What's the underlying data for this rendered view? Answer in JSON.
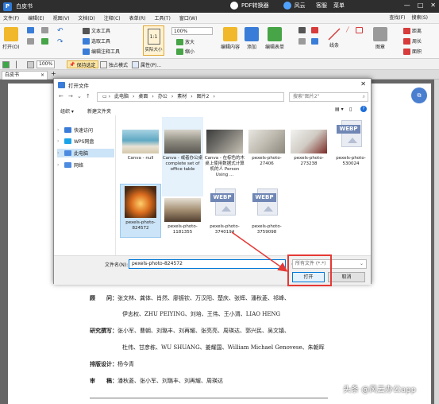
{
  "app": {
    "title": "白皮书",
    "center_items": [
      "PDF转换器",
      "风云"
    ],
    "right_items": [
      "客服",
      "菜单"
    ],
    "window_buttons": [
      "—",
      "□",
      "✕"
    ]
  },
  "menu": {
    "items": [
      "文件(F)",
      "编辑(E)",
      "视图(V)",
      "文档(D)",
      "注释(C)",
      "表单(R)",
      "工具(T)",
      "窗口(W)"
    ],
    "right": [
      "查找(F)",
      "搜索(S)"
    ]
  },
  "toolbar": {
    "open": "打开(O)",
    "text_tool": "文本工具",
    "select_tool": "选取工具",
    "edit_note_tool": "编辑注释工具",
    "actual_size": "实际大小",
    "zoom": "100%",
    "zoom_in": "放大",
    "zoom_out": "缩小",
    "edit_content": "编辑内容",
    "add": "添加",
    "edit_form": "编辑表单",
    "line": "线条",
    "stamp": "图章",
    "perimeter": "周长",
    "area": "面积",
    "distance": "距离"
  },
  "toolbar2": {
    "zoom2": "100%",
    "keep_selected": "保持选定",
    "single_mode": "独占模式",
    "properties": "属性(P)..."
  },
  "tab": {
    "label": "白皮书",
    "close": "×",
    "plus": "+"
  },
  "dialog": {
    "title": "打开文件",
    "close": "✕",
    "breadcrumb": [
      "此电脑",
      "桌面",
      "办公",
      "素材",
      "图片2"
    ],
    "search_placeholder": "搜索\"图片2\"",
    "organize": "组织 ▾",
    "new_folder": "新建文件夹",
    "nav": [
      {
        "label": "快速访问",
        "icon": "star-icon"
      },
      {
        "label": "WPS网盘",
        "icon": "cloud-icon"
      },
      {
        "label": "此电脑",
        "icon": "computer-icon"
      },
      {
        "label": "网络",
        "icon": "network-icon"
      }
    ],
    "files": [
      {
        "name": "Canva - null",
        "kind": "ocean"
      },
      {
        "name": "Canva - 或者办公桌 complete set of office table",
        "kind": "desk"
      },
      {
        "name": "Canva - 在棕色的木桌上使用数据式计算机的人 Person Using ...",
        "kind": "laptop"
      },
      {
        "name": "pexels-photo-27406",
        "kind": "laptop2"
      },
      {
        "name": "pexels-photo-273238",
        "kind": "office"
      },
      {
        "name": "pexels-photo-530024",
        "kind": "webp"
      },
      {
        "name": "pexels-photo-824572",
        "kind": "tree"
      },
      {
        "name": "pexels-photo-1181355",
        "kind": "meeting"
      },
      {
        "name": "pexels-photo-3740194",
        "kind": "webp"
      },
      {
        "name": "pexels-photo-3759098",
        "kind": "webp"
      }
    ],
    "filename_label": "文件名(N):",
    "filename_value": "pexels-photo-824572",
    "filetype": "所有文件 (*.*)",
    "open_button": "打开",
    "cancel_button": "取消"
  },
  "document": {
    "lines": [
      {
        "label": "顾　　问：",
        "text": "张文林、龚体、肖然、廖振钦、万汉阳、楚庆、张辉、潘秋菱、祁峰、"
      },
      {
        "label": "",
        "text": "伊志权、ZHU PEIYING、刘培、王伟、王小渭、LIAO HENG"
      },
      {
        "label": "研究撰写：",
        "text": "张小军、曹朝、刘璐丰、刘再耀、张亮亮、周瑛达、郭兴民、吴文镇、"
      },
      {
        "label": "",
        "text": "杜伟、甘彦栋、WU SHUANG、姜耀国、William Michael Genovese、朱朝晖"
      },
      {
        "label": "排版设计：",
        "text": "杨今青"
      },
      {
        "label": "审　　稿：",
        "text": "潘秋菱、张小军、刘璐丰、刘再耀、周瑛达"
      }
    ]
  },
  "watermark": "头条 @风云办公app",
  "colors": {
    "titlebar": "#2e2e2e",
    "accent": "#0078d7",
    "selection": "#cce4f7",
    "annotation_red": "#e53935"
  }
}
